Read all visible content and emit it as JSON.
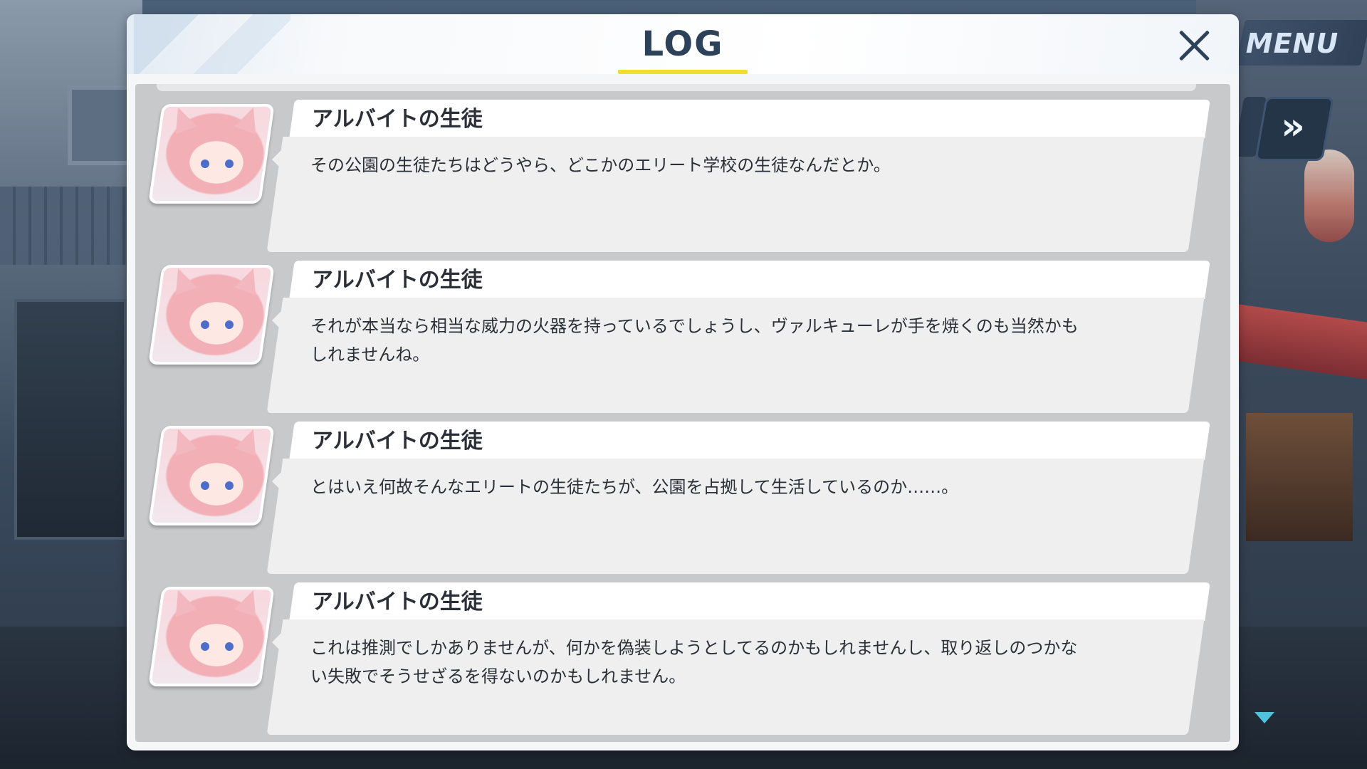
{
  "header": {
    "title": "LOG"
  },
  "hud": {
    "menu_label": "MENU",
    "skip_icon": "»"
  },
  "log": {
    "entries": [
      {
        "speaker": "アルバイトの生徒",
        "text": "その公園の生徒たちはどうやら、どこかのエリート学校の生徒なんだとか。"
      },
      {
        "speaker": "アルバイトの生徒",
        "text": "それが本当なら相当な威力の火器を持っているでしょうし、ヴァルキューレが手を焼くのも当然かもしれませんね。"
      },
      {
        "speaker": "アルバイトの生徒",
        "text": "とはいえ何故そんなエリートの生徒たちが、公園を占拠して生活しているのか……。"
      },
      {
        "speaker": "アルバイトの生徒",
        "text": "これは推測でしかありませんが、何かを偽装しようとしてるのかもしれませんし、取り返しのつかない失敗でそうせざるを得ないのかもしれません。"
      }
    ]
  },
  "colors": {
    "title_text": "#2d4159",
    "title_underline": "#f2dd2c",
    "scroll_arrow": "#4fc3dc"
  },
  "icons": {
    "close": "close-icon",
    "skip": "fast-forward-icon",
    "scroll": "chevron-down-icon"
  }
}
